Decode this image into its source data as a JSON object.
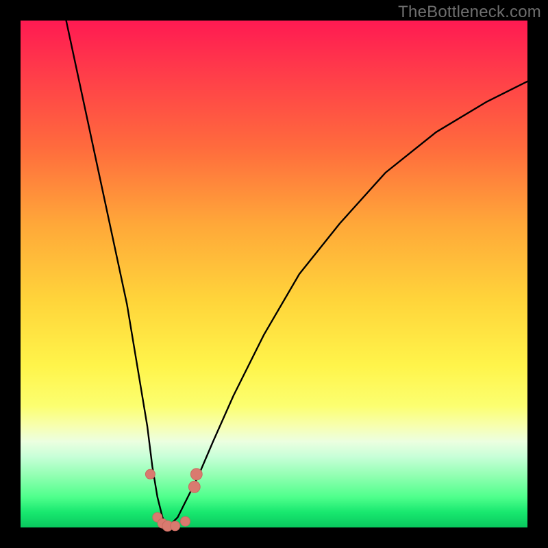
{
  "watermark": "TheBottleneck.com",
  "colors": {
    "frame": "#000000",
    "curve": "#000000",
    "marker": "#d97a6f",
    "marker_stroke": "#c86a60"
  },
  "chart_data": {
    "type": "line",
    "title": "",
    "xlabel": "",
    "ylabel": "",
    "xlim": [
      0,
      100
    ],
    "ylim": [
      0,
      100
    ],
    "grid": false,
    "legend": false,
    "note": "V-shaped bottleneck curve. x≈relative component strength, y≈bottleneck %. Minimum ≈0% near x≈29; curve rises steeply on both sides. Values estimated from pixels.",
    "series": [
      {
        "name": "bottleneck-curve",
        "x": [
          9,
          12,
          15,
          18,
          21,
          23,
          25,
          26,
          27,
          28,
          29,
          30,
          31,
          32,
          33,
          35,
          38,
          42,
          48,
          55,
          63,
          72,
          82,
          92,
          100
        ],
        "y": [
          100,
          86,
          72,
          58,
          44,
          32,
          20,
          12,
          6,
          2,
          0,
          1,
          2,
          4,
          6,
          10,
          17,
          26,
          38,
          50,
          60,
          70,
          78,
          84,
          88
        ]
      }
    ],
    "markers": [
      {
        "x": 25.6,
        "y": 10.5,
        "r": 1.0
      },
      {
        "x": 27.0,
        "y": 2.0,
        "r": 1.0
      },
      {
        "x": 28.0,
        "y": 0.8,
        "r": 1.0
      },
      {
        "x": 29.0,
        "y": 0.3,
        "r": 1.1
      },
      {
        "x": 30.5,
        "y": 0.3,
        "r": 1.0
      },
      {
        "x": 32.5,
        "y": 1.2,
        "r": 1.0
      },
      {
        "x": 34.3,
        "y": 8.0,
        "r": 1.2
      },
      {
        "x": 34.7,
        "y": 10.5,
        "r": 1.2
      }
    ]
  }
}
